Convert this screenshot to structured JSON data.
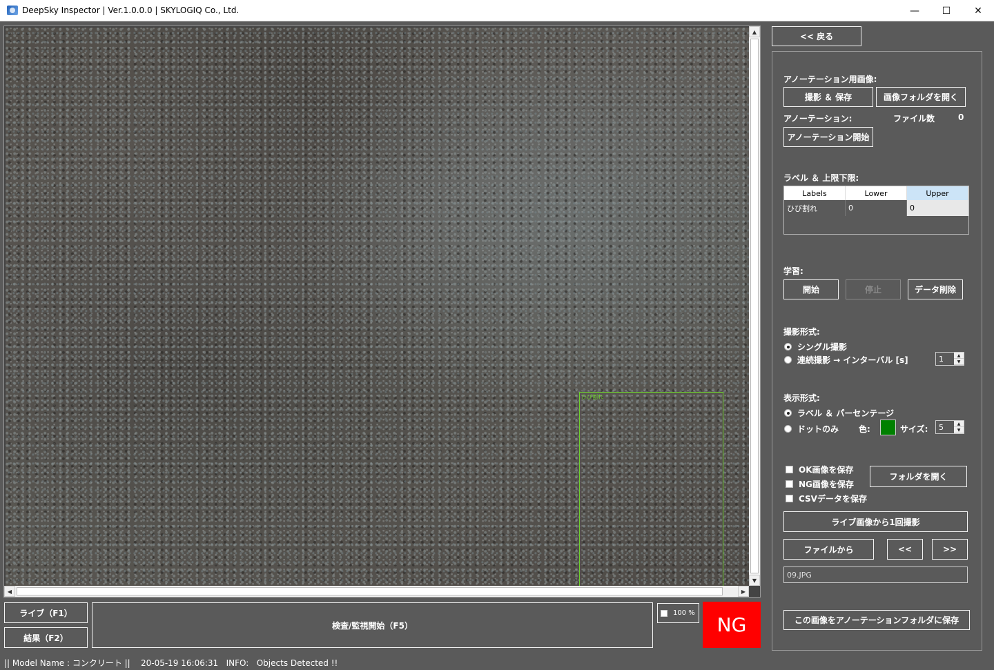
{
  "window": {
    "title": "DeepSky Inspector | Ver.1.0.0.0 | SKYLOGIQ Co., Ltd.",
    "minimize": "—",
    "maximize": "☐",
    "close": "✕"
  },
  "viewer": {
    "detection_label": "ひび割れ"
  },
  "bottom": {
    "live_button": "ライブ（F1）",
    "result_button": "結果（F2）",
    "inspect_button": "検査/監視開始（F5）",
    "zoom_value": "100 %",
    "verdict": "NG"
  },
  "status": {
    "text": "|| Model Name : コンクリート ||    20-05-19 16:06:31   INFO:   Objects Detected !!"
  },
  "panel": {
    "back_button": "<< 戻る",
    "annotation_image_label": "アノーテーション用画像:",
    "capture_save_button": "撮影 ＆ 保存",
    "open_image_folder_button": "画像フォルダを開く",
    "annotation_label": "アノーテーション:",
    "file_count_label": "ファイル数",
    "file_count_value": "0",
    "annotation_start_button": "アノーテーション開始",
    "label_limits_label": "ラベル ＆ 上限下限:",
    "grid": {
      "headers": [
        "Labels",
        "Lower",
        "Upper"
      ],
      "rows": [
        {
          "label": "ひび割れ",
          "lower": "0",
          "upper": "0"
        }
      ]
    },
    "training_label": "学習:",
    "train_start_button": "開始",
    "train_stop_button": "停止",
    "data_delete_button": "データ削除",
    "capture_mode_label": "撮影形式:",
    "single_capture": "シングル撮影",
    "continuous_capture": "連続撮影 → インターバル [s]",
    "interval_value": "1",
    "display_mode_label": "表示形式:",
    "label_percent": "ラベル ＆ パーセンテージ",
    "dot_only": "ドットのみ",
    "color_label": "色:",
    "size_label": "サイズ:",
    "size_value": "5",
    "dot_color": "#008000",
    "save_ok": "OK画像を保存",
    "save_ng": "NG画像を保存",
    "save_csv": "CSVデータを保存",
    "open_folder_button": "フォルダを開く",
    "live_capture_once_button": "ライブ画像から1回撮影",
    "from_file_button": "ファイルから",
    "prev_button": "<<",
    "next_button": ">>",
    "current_file": "09.JPG",
    "save_to_annotation_button": "この画像をアノーテーションフォルダに保存"
  }
}
